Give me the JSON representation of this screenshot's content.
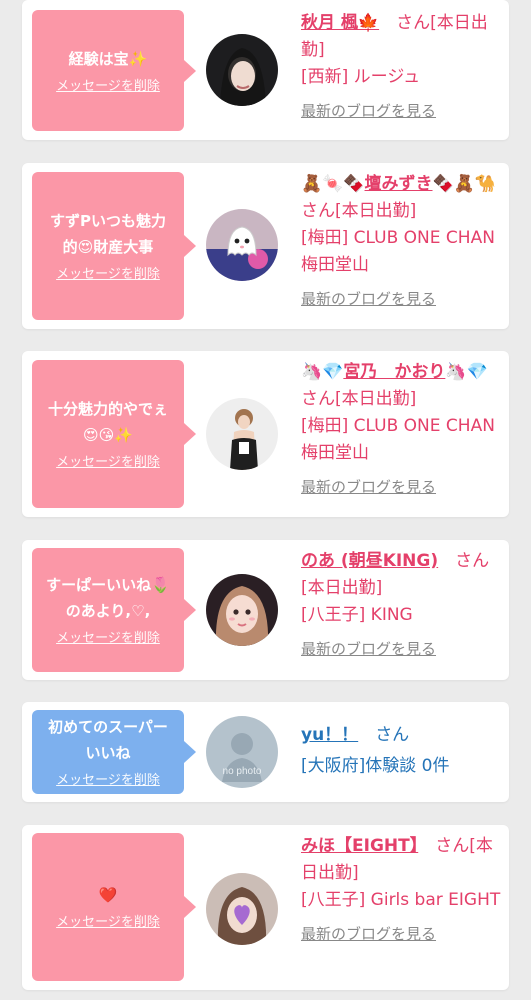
{
  "cards": [
    {
      "bubble_color": "#fb97a7",
      "message": "経験は宝✨",
      "delete_label": "メッセージを削除",
      "avatar_icon": "avatar-photo-dark-hair",
      "name_prefix": "",
      "name": "秋月 楓🍁",
      "name_suffix": "",
      "san": "さん",
      "status": "[本日出勤]",
      "shop": "[西新] ルージュ",
      "blog_label": "最新のブログを見る"
    },
    {
      "bubble_color": "#fb97a7",
      "message": "すずPいつも魅力\n的😍財産大事",
      "delete_label": "メッセージを削除",
      "avatar_icon": "avatar-photo-ghost-sticker",
      "name_prefix": "🧸🍬🍫",
      "name": "壇みずき",
      "name_suffix": "🍫🧸🐪",
      "san": "さん",
      "status": "[本日出勤]",
      "shop": "[梅田] CLUB ONE CHAN 梅田堂山",
      "blog_label": "最新のブログを見る"
    },
    {
      "bubble_color": "#fb97a7",
      "message": "十分魅力的やでぇ\n😍😘✨",
      "delete_label": "メッセージを削除",
      "avatar_icon": "avatar-photo-dress",
      "name_prefix": "🦄💎",
      "name": "宮乃　かおり",
      "name_suffix": "🦄💎",
      "san": "さん",
      "status": "[本日出勤]",
      "shop": "[梅田] CLUB ONE CHAN 梅田堂山",
      "blog_label": "最新のブログを見る"
    },
    {
      "bubble_color": "#fb97a7",
      "message": "すーぱーいいね🌷\nのあより,♡,",
      "delete_label": "メッセージを削除",
      "avatar_icon": "avatar-photo-selfie",
      "name_prefix": "",
      "name": "のあ (朝昼KING)",
      "name_suffix": "",
      "san": "さん",
      "status": "[本日出勤]",
      "shop": "[八王子] KING",
      "blog_label": "最新のブログを見る"
    },
    {
      "bubble_color": "#7db0ee",
      "message": "初めてのスーパー\nいいね",
      "delete_label": "メッセージを削除",
      "avatar_icon": "no-photo-silhouette-icon",
      "avatar_caption": "no photo",
      "name_prefix": "",
      "name": "yu！！",
      "name_suffix": "",
      "san": "さん",
      "status": "",
      "shop": "[大阪府]体験談 0件",
      "blog_label": ""
    },
    {
      "bubble_color": "#fb97a7",
      "message": "❤️",
      "delete_label": "メッセージを削除",
      "avatar_icon": "avatar-photo-heart-sticker",
      "name_prefix": "",
      "name": "みほ【EIGHT】",
      "name_suffix": "",
      "san": "さん",
      "status": "[本日出勤]",
      "shop": "[八王子] Girls bar EIGHT",
      "blog_label": "最新のブログを見る"
    }
  ]
}
